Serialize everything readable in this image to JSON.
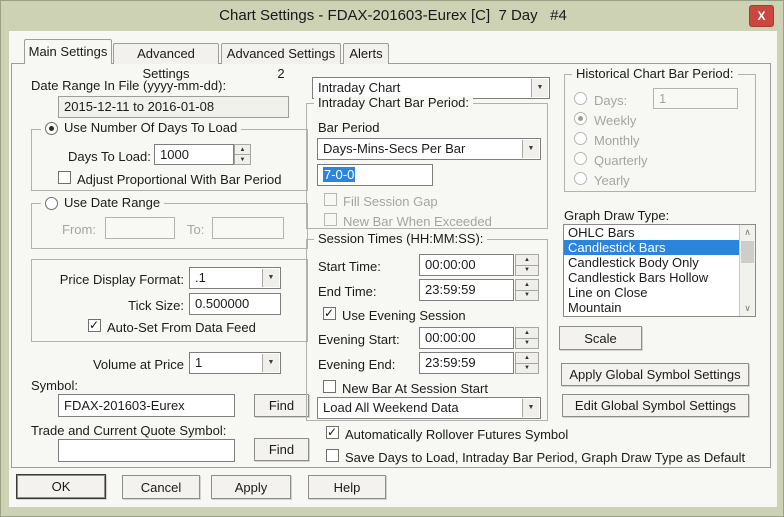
{
  "window": {
    "title": "Chart Settings - FDAX-201603-Eurex [C]  7 Day   #4",
    "close_label": "X"
  },
  "colors": {
    "frame_green": "#ccd2b3",
    "dialog_bg": "#f7f7f3",
    "selection_blue": "#2c85dd",
    "close_red": "#c9473f"
  },
  "tabs": {
    "items": [
      "Main Settings",
      "Advanced Settings",
      "Advanced Settings 2",
      "Alerts"
    ],
    "active": "Main Settings"
  },
  "left": {
    "date_range_label": "Date Range In File (yyyy-mm-dd):",
    "date_range_value": "2015-12-11 to 2016-01-08",
    "days_group_title": "Use Number Of Days To Load",
    "days_to_load_label": "Days To Load:",
    "days_to_load_value": "1000",
    "adjust_proportional_label": "Adjust Proportional With Bar Period",
    "date_range_group_title": "Use Date Range",
    "from_label": "From:",
    "from_value": "",
    "to_label": "To:",
    "to_value": "",
    "price_display_label": "Price Display Format:",
    "price_display_value": ".1",
    "tick_size_label": "Tick Size:",
    "tick_size_value": "0.500000",
    "auto_set_label": "Auto-Set From Data Feed",
    "volume_at_price_label": "Volume at Price",
    "volume_at_price_value": "1",
    "symbol_label": "Symbol:",
    "symbol_value": "FDAX-201603-Eurex",
    "find_button_label": "Find",
    "trade_symbol_label": "Trade and Current Quote Symbol:",
    "trade_symbol_value": "",
    "find2_button_label": "Find"
  },
  "middle": {
    "chart_type_value": "Intraday Chart",
    "bar_period_group_title": "Intraday Chart Bar Period:",
    "bar_period_label": "Bar Period",
    "bar_period_type_value": "Days-Mins-Secs Per Bar",
    "bar_period_value": "7-0-0",
    "fill_session_gap_label": "Fill Session Gap",
    "new_bar_when_exceeded_label": "New Bar When Exceeded",
    "session_group_title": "Session Times (HH:MM:SS):",
    "start_time_label": "Start Time:",
    "start_time_value": "00:00:00",
    "end_time_label": "End Time:",
    "end_time_value": "23:59:59",
    "use_evening_label": "Use Evening Session",
    "evening_start_label": "Evening Start:",
    "evening_start_value": "00:00:00",
    "evening_end_label": "Evening End:",
    "evening_end_value": "23:59:59",
    "new_bar_at_session_label": "New Bar At Session Start",
    "weekend_data_value": "Load All Weekend Data",
    "rollover_label": "Automatically Rollover Futures Symbol",
    "save_default_label": "Save Days to Load, Intraday Bar Period, Graph Draw Type as Default"
  },
  "right": {
    "historical_group_title": "Historical Chart Bar Period:",
    "days_label": "Days:",
    "days_value": "1",
    "weekly_label": "Weekly",
    "monthly_label": "Monthly",
    "quarterly_label": "Quarterly",
    "yearly_label": "Yearly",
    "graph_draw_label": "Graph Draw Type:",
    "graph_draw_type": {
      "items": [
        "OHLC Bars",
        "Candlestick Bars",
        "Candlestick Body Only",
        "Candlestick Bars Hollow",
        "Line on Close",
        "Mountain"
      ],
      "selected": "Candlestick Bars",
      "selected_index": 1
    },
    "scale_button_label": "Scale",
    "apply_global_button_label": "Apply Global Symbol Settings",
    "edit_global_button_label": "Edit Global Symbol Settings"
  },
  "footer": {
    "ok": "OK",
    "cancel": "Cancel",
    "apply": "Apply",
    "help": "Help"
  },
  "states": {
    "use_number_of_days": true,
    "adjust_proportional": false,
    "use_date_range": false,
    "auto_set_from_data_feed": true,
    "fill_session_gap": false,
    "new_bar_when_exceeded": false,
    "use_evening_session": true,
    "new_bar_at_session_start": false,
    "automatically_rollover": true,
    "save_as_default": false,
    "historical_days": false,
    "historical_weekly": true,
    "historical_monthly": false,
    "historical_quarterly": false,
    "historical_yearly": false
  }
}
